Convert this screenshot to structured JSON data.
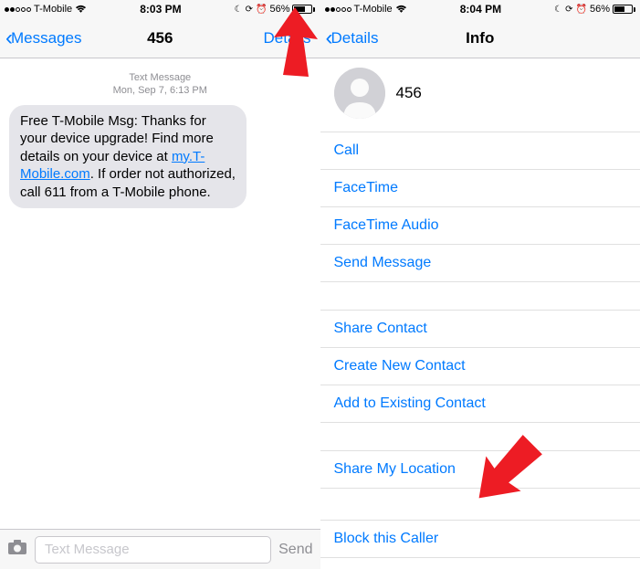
{
  "left": {
    "status": {
      "carrier": "T-Mobile",
      "time": "8:03 PM",
      "battery": "56%"
    },
    "nav": {
      "back": "Messages",
      "title": "456",
      "right": "Details"
    },
    "meta": {
      "type": "Text Message",
      "when": "Mon, Sep 7, 6:13 PM"
    },
    "bubble": {
      "pre": "Free T-Mobile Msg: Thanks for your device upgrade! Find more details on your device at ",
      "link": "my.T-Mobile.com",
      "post": ". If order not authorized, call 611 from a T-Mobile phone."
    },
    "composer": {
      "placeholder": "Text Message",
      "send": "Send"
    }
  },
  "right": {
    "status": {
      "carrier": "T-Mobile",
      "time": "8:04 PM",
      "battery": "56%"
    },
    "nav": {
      "back": "Details",
      "title": "Info"
    },
    "contact": "456",
    "rows1": [
      "Call",
      "FaceTime",
      "FaceTime Audio",
      "Send Message"
    ],
    "rows2": [
      "Share Contact",
      "Create New Contact",
      "Add to Existing Contact"
    ],
    "rows3": [
      "Share My Location"
    ],
    "rows4": [
      "Block this Caller"
    ]
  }
}
